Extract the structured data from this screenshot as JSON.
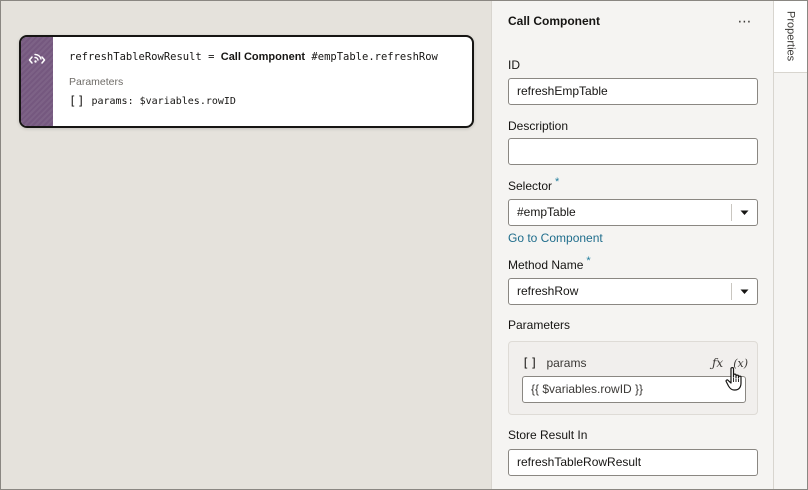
{
  "node": {
    "result_var": "refreshTableRowResult",
    "equals": "=",
    "action": "Call Component",
    "target": "#empTable.refreshRow",
    "params_label": "Parameters",
    "param_text": "params: $variables.rowID",
    "icon": "call-component-icon",
    "color": "#75587f"
  },
  "panel": {
    "title": "Call Component",
    "more": "⋯",
    "id_label": "ID",
    "id_value": "refreshEmpTable",
    "description_label": "Description",
    "description_value": "",
    "selector_label": "Selector",
    "selector_value": "#empTable",
    "required_mark": "*",
    "go_to_component": "Go to Component",
    "method_label": "Method Name",
    "method_value": "refreshRow",
    "parameters_label": "Parameters",
    "param_name": "params",
    "param_value": "{{ $variables.rowID }}",
    "fx_label": "ƒx",
    "var_label": "(x)",
    "store_label": "Store Result In",
    "store_value": "refreshTableRowResult"
  },
  "tabs": {
    "properties": "Properties"
  },
  "colors": {
    "link": "#1f6d8c",
    "required": "#227e9e",
    "canvas": "#e5e2dc"
  }
}
